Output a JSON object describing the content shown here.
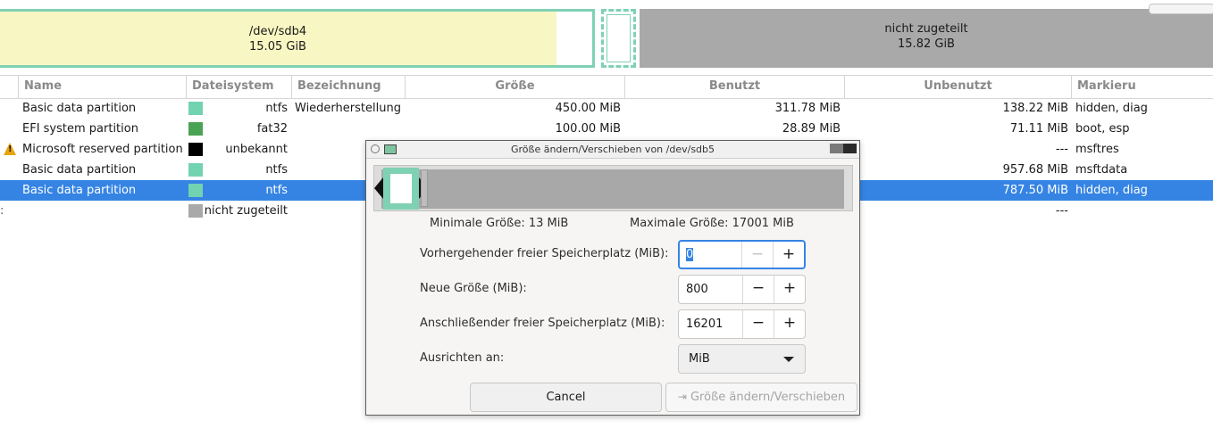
{
  "diskmap": {
    "sdb4": {
      "name": "/dev/sdb4",
      "size": "15.05 GiB"
    },
    "unallocated": {
      "name": "nicht zugeteilt",
      "size": "15.82 GiB"
    }
  },
  "columns": [
    "Name",
    "Dateisystem",
    "Bezeichnung",
    "Größe",
    "Benutzt",
    "Unbenutzt",
    "Markieru"
  ],
  "rows": [
    {
      "name": "Basic data partition",
      "fs": "ntfs",
      "fs_color": "#72d3b0",
      "label": "Wiederherstellung",
      "size": "450.00 MiB",
      "used": "311.78 MiB",
      "unused": "138.22 MiB",
      "flags": "hidden, diag"
    },
    {
      "name": "EFI system partition",
      "fs": "fat32",
      "fs_color": "#4aa354",
      "label": "",
      "size": "100.00 MiB",
      "used": "28.89 MiB",
      "unused": "71.11 MiB",
      "flags": "boot, esp"
    },
    {
      "name": "Microsoft reserved partition",
      "fs": "unbekannt",
      "fs_color": "#000000",
      "label": "",
      "size": "",
      "used": "",
      "unused": "---",
      "flags": "msftres",
      "warning": true
    },
    {
      "name": "Basic data partition",
      "fs": "ntfs",
      "fs_color": "#72d3b0",
      "label": "",
      "size": "",
      "used": "",
      "unused": "957.68 MiB",
      "flags": "msftdata"
    },
    {
      "name": "Basic data partition",
      "fs": "ntfs",
      "fs_color": "#72d3b0",
      "label": "",
      "size": "",
      "used": "",
      "unused": "787.50 MiB",
      "flags": "hidden, diag",
      "selected": true
    },
    {
      "name": "",
      "fs": "nicht zugeteilt",
      "fs_color": "#a9a9a9",
      "label": "",
      "size": "",
      "used": "",
      "unused": "---",
      "flags": ""
    }
  ],
  "dialog": {
    "title": "Größe ändern/Verschieben von /dev/sdb5",
    "min_size": "Minimale Größe: 13 MiB",
    "max_size": "Maximale Größe: 17001 MiB",
    "preceding_label": "Vorhergehender freier Speicherplatz (MiB):",
    "preceding_value": "0",
    "new_size_label": "Neue Größe (MiB):",
    "new_size_value": "800",
    "following_label": "Anschließender freier Speicherplatz (MiB):",
    "following_value": "16201",
    "align_label": "Ausrichten an:",
    "align_value": "MiB",
    "cancel": "Cancel",
    "resize": "Größe ändern/Verschieben",
    "minus": "−",
    "plus": "+"
  }
}
